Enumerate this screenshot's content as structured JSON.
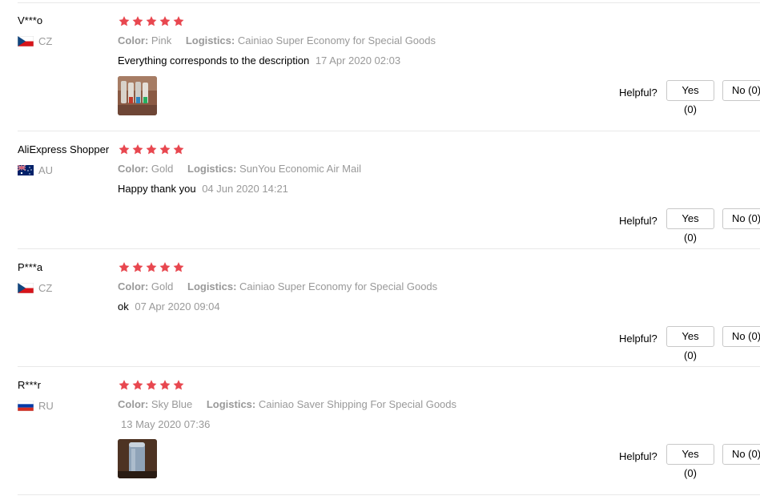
{
  "reviews": [
    {
      "user": "V***o",
      "country": "CZ",
      "flag": "czech-flag",
      "rating": 5,
      "color_label": "Color:",
      "color_value": "Pink",
      "logistics_label": "Logistics:",
      "logistics_value": "Cainiao Super Economy for Special Goods",
      "text": "Everything corresponds to the description",
      "date": "17 Apr 2020 02:03",
      "has_photo": true,
      "helpful_label": "Helpful?",
      "yes_label": "Yes (0)",
      "no_label": "No (0)"
    },
    {
      "user": "AliExpress Shopper",
      "country": "AU",
      "flag": "australia-flag",
      "rating": 5,
      "color_label": "Color:",
      "color_value": "Gold",
      "logistics_label": "Logistics:",
      "logistics_value": "SunYou Economic Air Mail",
      "text": "Happy thank you",
      "date": "04 Jun 2020 14:21",
      "has_photo": false,
      "helpful_label": "Helpful?",
      "yes_label": "Yes (0)",
      "no_label": "No (0)"
    },
    {
      "user": "P***a",
      "country": "CZ",
      "flag": "czech-flag",
      "rating": 5,
      "color_label": "Color:",
      "color_value": "Gold",
      "logistics_label": "Logistics:",
      "logistics_value": "Cainiao Super Economy for Special Goods",
      "text": "ok",
      "date": "07 Apr 2020 09:04",
      "has_photo": false,
      "helpful_label": "Helpful?",
      "yes_label": "Yes (0)",
      "no_label": "No (0)"
    },
    {
      "user": "R***r",
      "country": "RU",
      "flag": "russia-flag",
      "rating": 5,
      "color_label": "Color:",
      "color_value": "Sky Blue",
      "logistics_label": "Logistics:",
      "logistics_value": "Cainiao Saver Shipping For Special Goods",
      "text": "",
      "date": "13 May 2020 07:36",
      "has_photo": true,
      "helpful_label": "Helpful?",
      "yes_label": "Yes (0)",
      "no_label": "No (0)"
    }
  ],
  "colors": {
    "star": "#e8474f",
    "muted_text": "#999999",
    "divider": "#e8e8e8"
  }
}
